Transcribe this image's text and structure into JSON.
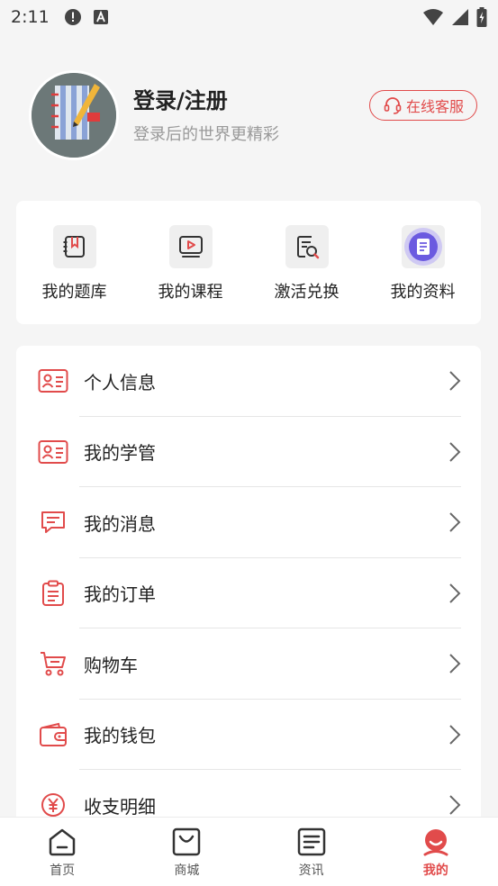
{
  "status": {
    "time": "2:11"
  },
  "profile": {
    "title": "登录/注册",
    "subtitle": "登录后的世界更精彩",
    "service_label": "在线客服"
  },
  "quick": [
    {
      "label": "我的题库",
      "icon": "bookmark-book-icon"
    },
    {
      "label": "我的课程",
      "icon": "video-play-icon"
    },
    {
      "label": "激活兑换",
      "icon": "search-document-icon"
    },
    {
      "label": "我的资料",
      "icon": "document-icon"
    }
  ],
  "menu": [
    {
      "label": "个人信息",
      "icon": "id-card-icon"
    },
    {
      "label": "我的学管",
      "icon": "id-card-icon"
    },
    {
      "label": "我的消息",
      "icon": "message-icon"
    },
    {
      "label": "我的订单",
      "icon": "clipboard-icon"
    },
    {
      "label": "购物车",
      "icon": "cart-icon"
    },
    {
      "label": "我的钱包",
      "icon": "wallet-icon"
    },
    {
      "label": "收支明细",
      "icon": "yuan-icon"
    }
  ],
  "tabs": [
    {
      "label": "首页",
      "icon": "home-icon"
    },
    {
      "label": "商城",
      "icon": "shop-bag-icon"
    },
    {
      "label": "资讯",
      "icon": "news-icon"
    },
    {
      "label": "我的",
      "icon": "user-icon",
      "active": true
    }
  ],
  "colors": {
    "accent": "#e14b4b",
    "quick_icon_bg": "#efefef",
    "document_icon": "#6b5ae0"
  }
}
